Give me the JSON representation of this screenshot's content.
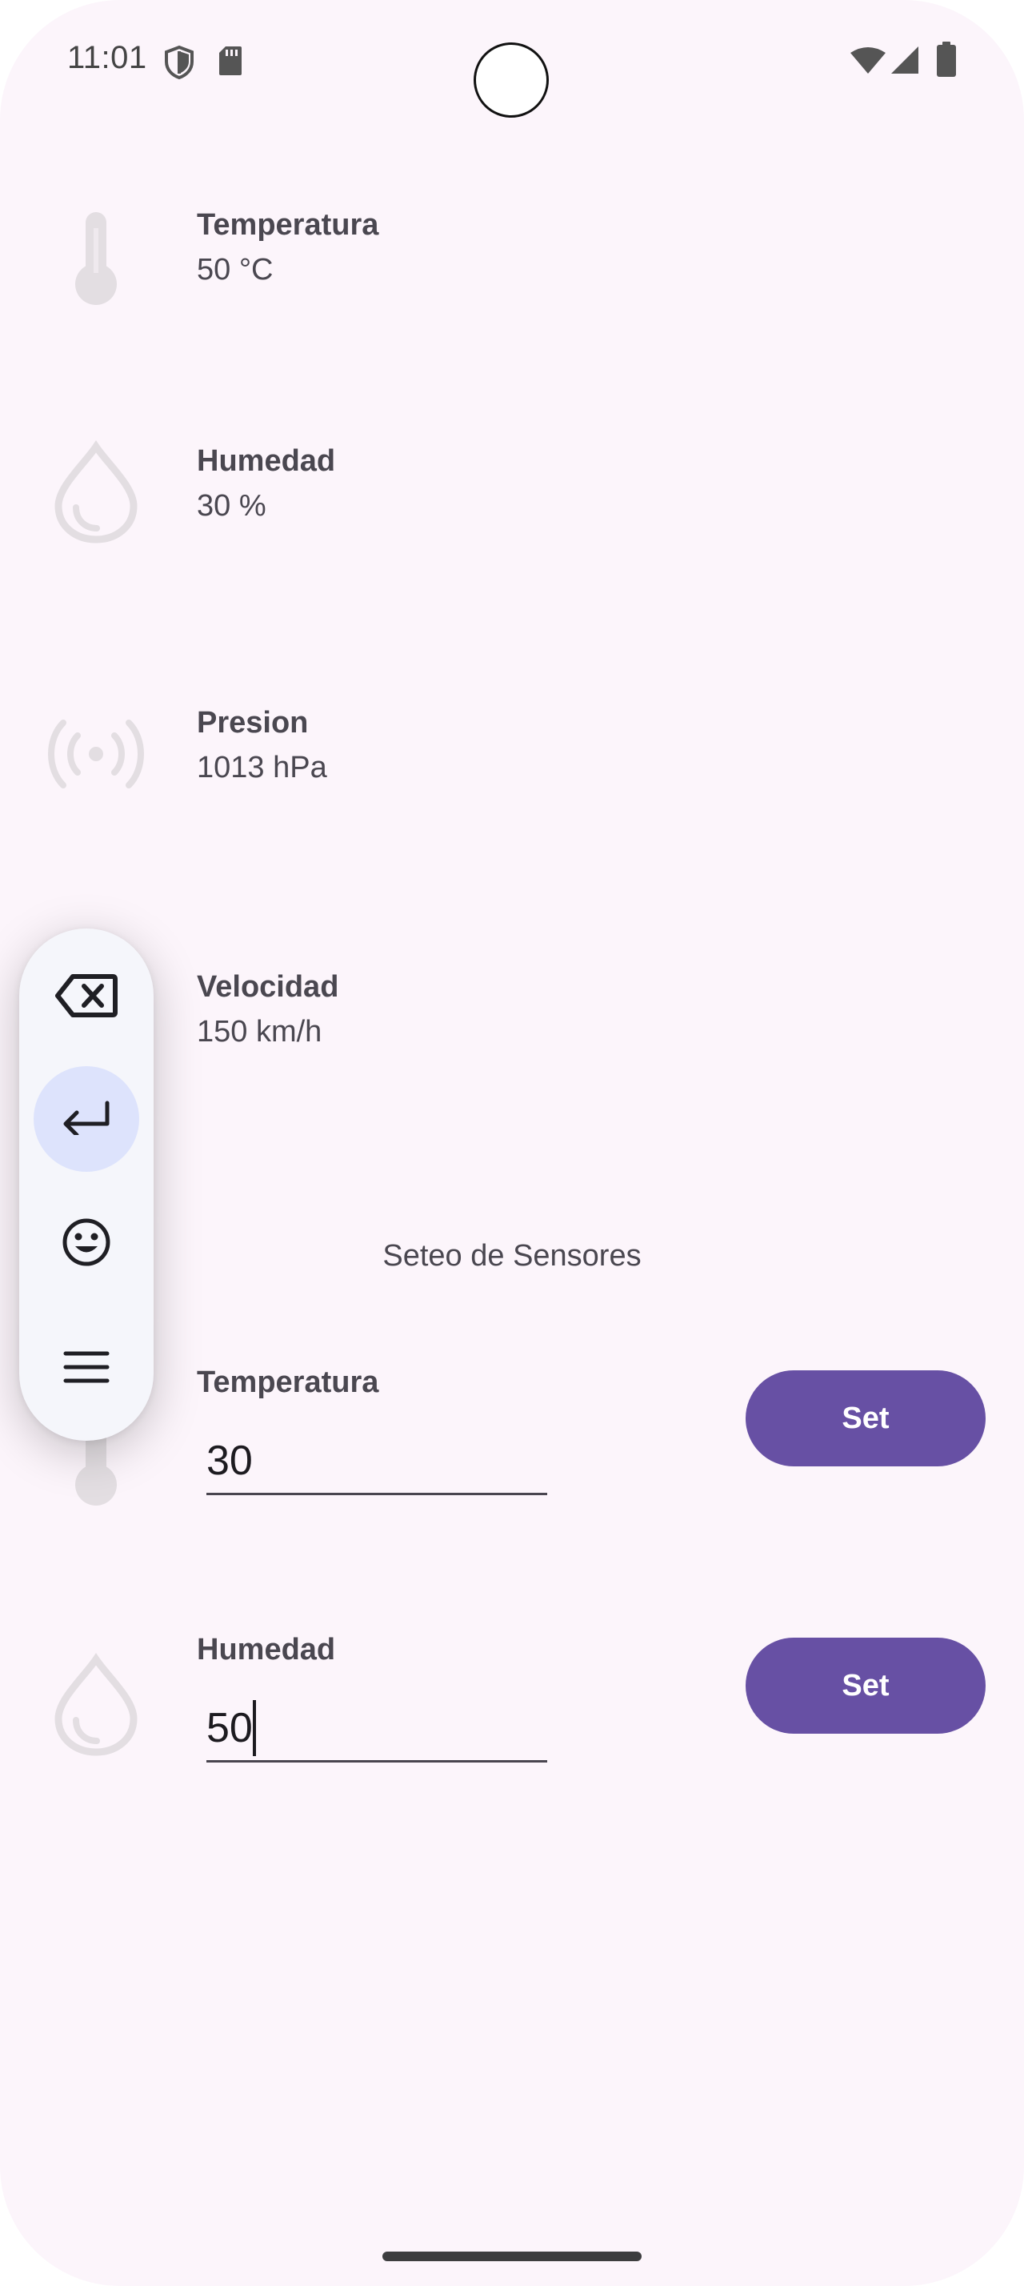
{
  "status_bar": {
    "time": "11:01",
    "left_icons": [
      "shield-icon",
      "sd-card-icon"
    ],
    "right_icons": [
      "wifi-icon",
      "cell-signal-icon",
      "battery-icon"
    ]
  },
  "sensors": [
    {
      "icon": "thermometer-icon",
      "title": "Temperatura",
      "value": "50 °C"
    },
    {
      "icon": "water-drop-icon",
      "title": "Humedad",
      "value": "30 %"
    },
    {
      "icon": "sensor-signal-icon",
      "title": "Presion",
      "value": "1013 hPa"
    },
    {
      "icon": "speed-icon",
      "title": "Velocidad",
      "value": "150 km/h"
    }
  ],
  "settings": {
    "section_title": "Seteo de Sensores",
    "rows": [
      {
        "icon": "thermometer-icon",
        "title": "Temperatura",
        "input_value": "30",
        "button_label": "Set"
      },
      {
        "icon": "water-drop-icon",
        "title": "Humedad",
        "input_value": "50",
        "button_label": "Set"
      }
    ]
  },
  "floating_toolbar": {
    "buttons": [
      {
        "icon": "backspace-icon",
        "active": false
      },
      {
        "icon": "enter-icon",
        "active": true
      },
      {
        "icon": "emoji-icon",
        "active": false
      },
      {
        "icon": "menu-icon",
        "active": false
      }
    ]
  },
  "colors": {
    "background": "#fcf5fb",
    "primary": "#6750a4",
    "text": "#4a4750",
    "toolbar_bg": "#f5f6fb",
    "toolbar_active": "#dde3fc"
  }
}
